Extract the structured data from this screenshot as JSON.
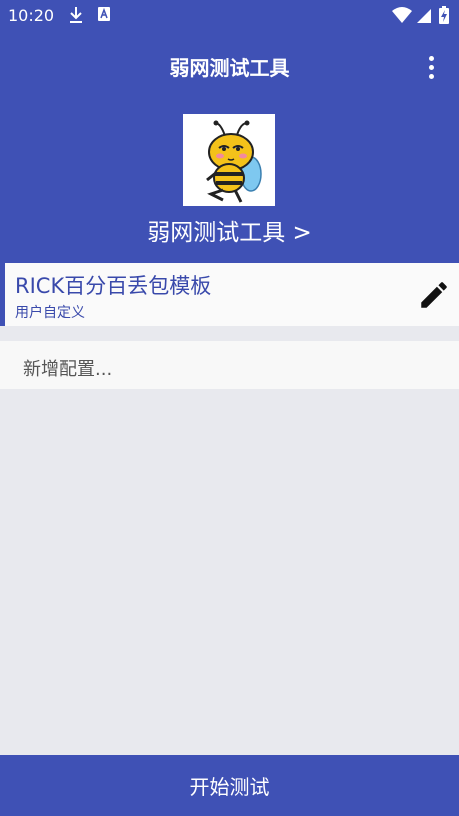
{
  "status_bar": {
    "time": "10:20",
    "icons": [
      "download-icon",
      "keyboard-a-icon",
      "wifi-icon",
      "signal-icon",
      "battery-charging-icon"
    ]
  },
  "header": {
    "title": "弱网测试工具",
    "menu_icon": "more-vert-icon",
    "logo": "bee-mascot",
    "link_text": "弱网测试工具 >"
  },
  "configs": [
    {
      "name": "RICK百分百丢包模板",
      "subtitle": "用户自定义",
      "action_icon": "edit-pencil-icon"
    }
  ],
  "add_config": {
    "label": "新增配置..."
  },
  "footer": {
    "start_label": "开始测试"
  },
  "colors": {
    "primary": "#3f51b5",
    "accent_text": "#3949ab",
    "background": "#e8e9ee"
  }
}
